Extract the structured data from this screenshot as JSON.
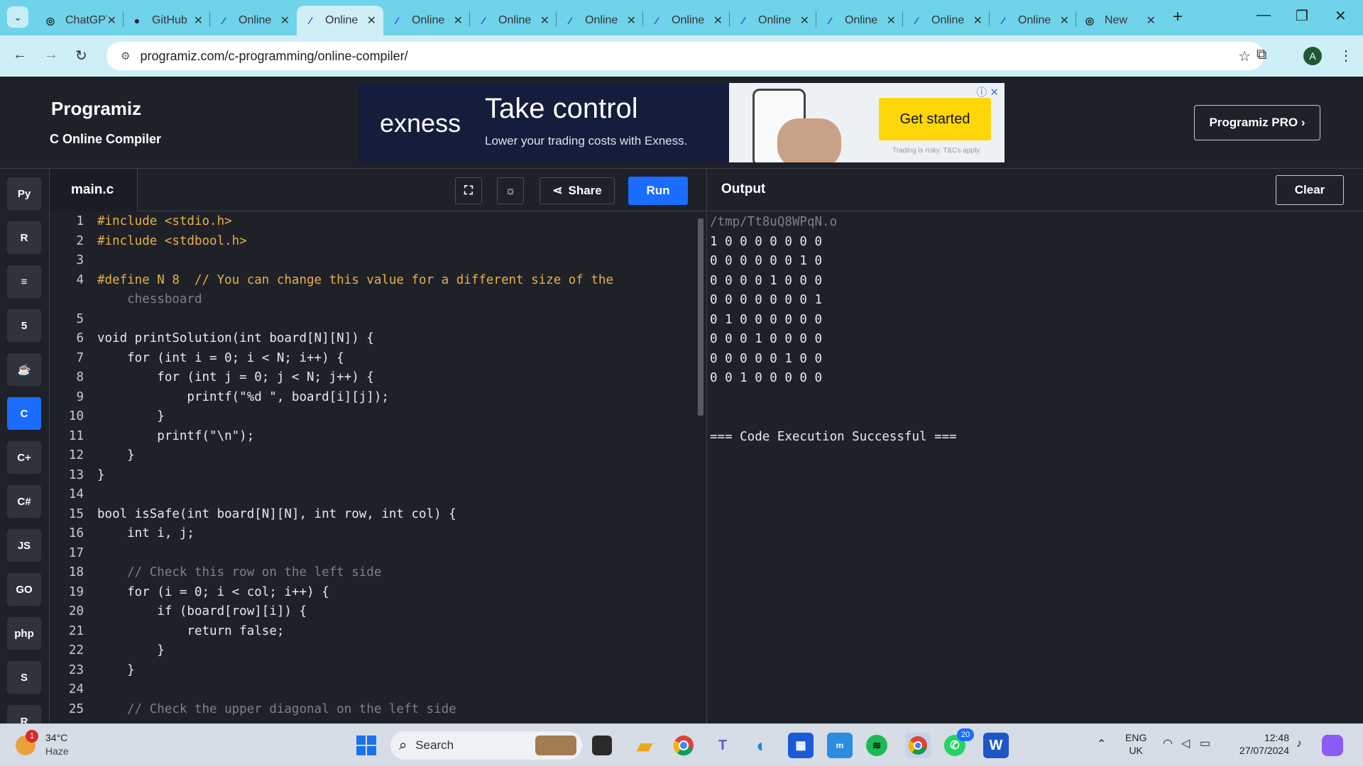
{
  "browser": {
    "tabs": [
      {
        "title": "ChatGPT",
        "icon": "chatgpt-icon"
      },
      {
        "title": "GitHub",
        "icon": "github-icon"
      },
      {
        "title": "Online",
        "icon": "programiz-icon"
      },
      {
        "title": "Online",
        "icon": "programiz-icon",
        "active": true
      },
      {
        "title": "Online",
        "icon": "programiz-icon"
      },
      {
        "title": "Online",
        "icon": "programiz-icon"
      },
      {
        "title": "Online",
        "icon": "programiz-icon"
      },
      {
        "title": "Online",
        "icon": "programiz-icon"
      },
      {
        "title": "Online",
        "icon": "programiz-icon"
      },
      {
        "title": "Online",
        "icon": "programiz-icon"
      },
      {
        "title": "Online",
        "icon": "programiz-icon"
      },
      {
        "title": "Online",
        "icon": "programiz-icon"
      },
      {
        "title": "New",
        "icon": "chrome-icon"
      }
    ],
    "url": "programiz.com/c-programming/online-compiler/",
    "avatar": "A"
  },
  "header": {
    "logo": "Programiz",
    "subtitle": "C Online Compiler",
    "pro_button": "Programiz PRO ›"
  },
  "ad": {
    "brand": "exness",
    "headline": "Take control",
    "subline": "Lower your trading costs with Exness.",
    "cta": "Get started",
    "disclaimer": "Trading is risky. T&Cs apply."
  },
  "sidebar": {
    "languages": [
      {
        "name": "python",
        "label": "Py"
      },
      {
        "name": "r",
        "label": "R"
      },
      {
        "name": "sql",
        "label": "≡"
      },
      {
        "name": "html",
        "label": "5"
      },
      {
        "name": "java",
        "label": "☕"
      },
      {
        "name": "c",
        "label": "C",
        "active": true
      },
      {
        "name": "cpp",
        "label": "C+"
      },
      {
        "name": "csharp",
        "label": "C#"
      },
      {
        "name": "javascript",
        "label": "JS"
      },
      {
        "name": "go",
        "label": "GO"
      },
      {
        "name": "php",
        "label": "php"
      },
      {
        "name": "swift",
        "label": "S"
      },
      {
        "name": "rust",
        "label": "R"
      }
    ]
  },
  "editor": {
    "filename": "main.c",
    "share_label": "Share",
    "run_label": "Run",
    "lines": [
      {
        "n": "1",
        "text": "#include <stdio.h>"
      },
      {
        "n": "2",
        "text": "#include <stdbool.h>"
      },
      {
        "n": "3",
        "text": ""
      },
      {
        "n": "4",
        "text": "#define N 8  // You can change this value for a different size of the"
      },
      {
        "n": "",
        "text": "    chessboard"
      },
      {
        "n": "5",
        "text": ""
      },
      {
        "n": "6",
        "text": "void printSolution(int board[N][N]) {"
      },
      {
        "n": "7",
        "text": "    for (int i = 0; i < N; i++) {"
      },
      {
        "n": "8",
        "text": "        for (int j = 0; j < N; j++) {"
      },
      {
        "n": "9",
        "text": "            printf(\"%d \", board[i][j]);"
      },
      {
        "n": "10",
        "text": "        }"
      },
      {
        "n": "11",
        "text": "        printf(\"\\n\");"
      },
      {
        "n": "12",
        "text": "    }"
      },
      {
        "n": "13",
        "text": "}"
      },
      {
        "n": "14",
        "text": ""
      },
      {
        "n": "15",
        "text": "bool isSafe(int board[N][N], int row, int col) {"
      },
      {
        "n": "16",
        "text": "    int i, j;"
      },
      {
        "n": "17",
        "text": ""
      },
      {
        "n": "18",
        "text": "    // Check this row on the left side"
      },
      {
        "n": "19",
        "text": "    for (i = 0; i < col; i++) {"
      },
      {
        "n": "20",
        "text": "        if (board[row][i]) {"
      },
      {
        "n": "21",
        "text": "            return false;"
      },
      {
        "n": "22",
        "text": "        }"
      },
      {
        "n": "23",
        "text": "    }"
      },
      {
        "n": "24",
        "text": ""
      },
      {
        "n": "25",
        "text": "    // Check the upper diagonal on the left side"
      }
    ]
  },
  "output": {
    "label": "Output",
    "clear_label": "Clear",
    "lines": [
      "/tmp/Tt8uQ8WPqN.o",
      "1 0 0 0 0 0 0 0",
      "0 0 0 0 0 0 1 0",
      "0 0 0 0 1 0 0 0",
      "0 0 0 0 0 0 0 1",
      "0 1 0 0 0 0 0 0",
      "0 0 0 1 0 0 0 0",
      "0 0 0 0 0 1 0 0",
      "0 0 1 0 0 0 0 0",
      "",
      "",
      "=== Code Execution Successful ==="
    ]
  },
  "taskbar": {
    "weather_temp": "34°C",
    "weather_desc": "Haze",
    "weather_badge": "1",
    "search_label": "Search",
    "lang_top": "ENG",
    "lang_bottom": "UK",
    "time": "12:48",
    "date": "27/07/2024",
    "whatsapp_badge": "20"
  }
}
